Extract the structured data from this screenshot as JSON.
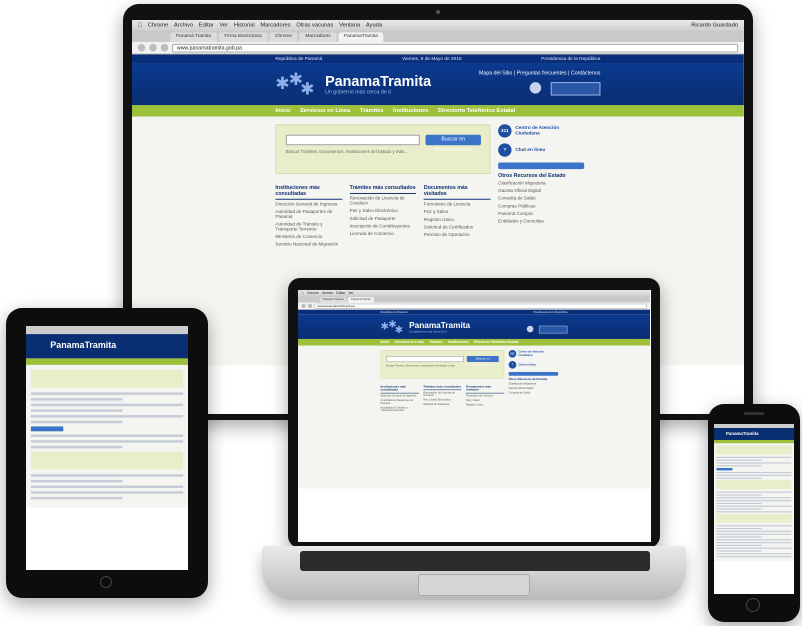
{
  "browser": {
    "menubar": [
      "Chrome",
      "Archivo",
      "Editar",
      "Ver",
      "Historial",
      "Marcadores",
      "Otras vacunas",
      "Ventana",
      "Ayuda"
    ],
    "status_right": "Ricardo Guardado",
    "tabs": [
      "Panamá Tramita",
      "Firma Electrónica",
      "Chrome",
      "Marcadores",
      "PanamaTramita"
    ],
    "url": "www.panamatramita.gob.pa"
  },
  "site": {
    "topstrip_left": "República de Panamá",
    "topstrip_mid": "Viernes, 8 de Mayo de 2015",
    "topstrip_right": "Presidencia de la República",
    "logo_name": "PanamaTramita",
    "logo_tag": "Un gobierno más cerca de ti",
    "header_links": "Mapa del Sitio | Preguntas frecuentes | Contáctenos",
    "nav": [
      "Inicio",
      "Servicios en Línea",
      "Trámites",
      "Instituciones",
      "Directorio Telefónico Estatal"
    ],
    "search_button": "Buscar en PanamaTramita",
    "search_hint": "Buscar Trámites, Documentos, Instituciones del Estado y más...",
    "columns": [
      {
        "title": "Instituciones más consultadas",
        "items": [
          "Dirección General de Ingresos",
          "Autoridad de Pasaportes de Panamá",
          "Autoridad de Tránsito y Transporte Terrestre",
          "Ministerio de Comercio",
          "Servicio Nacional de Migración"
        ]
      },
      {
        "title": "Trámites más consultados",
        "items": [
          "Renovación de Licencia de Conducir",
          "Paz y Salvo Electrónico",
          "Solicitud de Pasaporte",
          "Inscripción de Contribuyentes",
          "Licencia de Comercio"
        ]
      },
      {
        "title": "Documentos más visitados",
        "items": [
          "Formulario de Licencia",
          "Paz y Salvo",
          "Registro Único",
          "Solicitud de Certificados",
          "Permiso de Operación"
        ]
      }
    ],
    "right": {
      "badge_311": "311",
      "label_311": "Centro de Atención Ciudadana",
      "chat": "Chat en línea",
      "panel_title": "Otros Recursos del Estado",
      "links": [
        "Clasificación Migratoria",
        "Gaceta Oficial Digital",
        "Consulta de Saldo",
        "Compras Públicas",
        "Panamá Compra",
        "Entidades y Consultas"
      ]
    }
  },
  "mobile": {
    "logo_name": "PanamaTramita"
  }
}
